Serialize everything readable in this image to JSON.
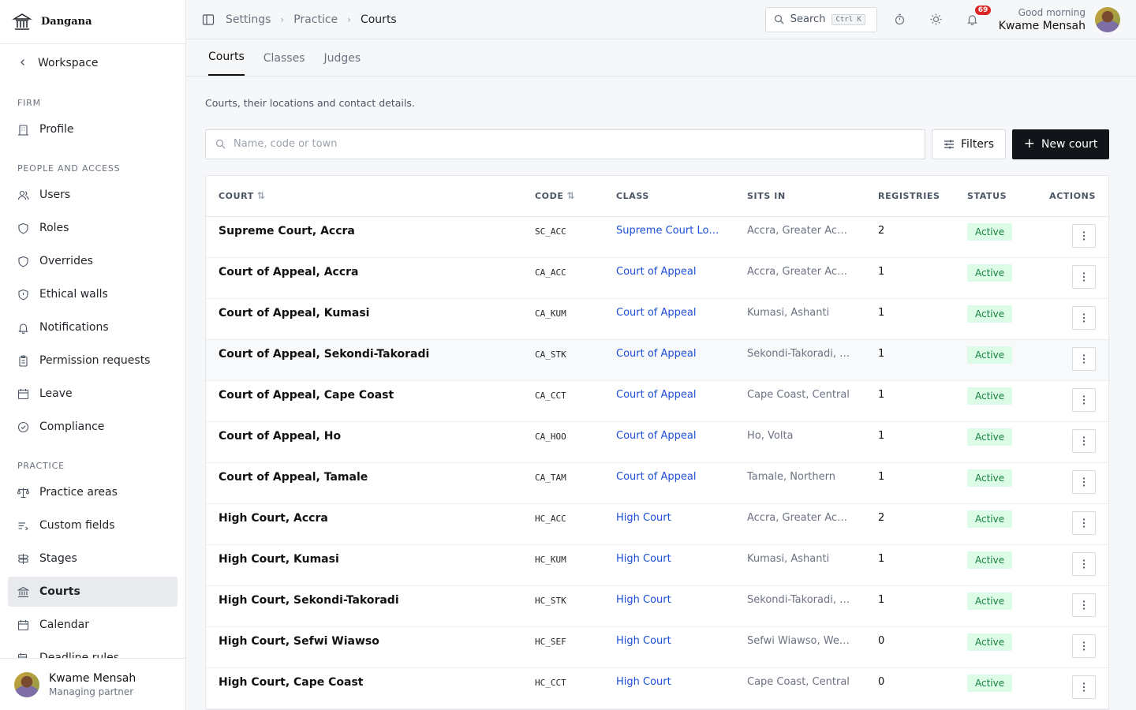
{
  "brand": {
    "name": "Dangana"
  },
  "sidebar": {
    "back_label": "Workspace",
    "sections": [
      {
        "label": "FIRM",
        "items": [
          {
            "label": "Profile",
            "icon": "building-icon"
          }
        ]
      },
      {
        "label": "PEOPLE AND ACCESS",
        "items": [
          {
            "label": "Users",
            "icon": "users-icon"
          },
          {
            "label": "Roles",
            "icon": "shield-icon"
          },
          {
            "label": "Overrides",
            "icon": "shield-icon"
          },
          {
            "label": "Ethical walls",
            "icon": "shield-alert-icon"
          },
          {
            "label": "Notifications",
            "icon": "bell-icon"
          },
          {
            "label": "Permission requests",
            "icon": "clipboard-icon"
          },
          {
            "label": "Leave",
            "icon": "calendar-icon"
          },
          {
            "label": "Compliance",
            "icon": "check-circle-icon"
          }
        ]
      },
      {
        "label": "PRACTICE",
        "items": [
          {
            "label": "Practice areas",
            "icon": "scale-icon"
          },
          {
            "label": "Custom fields",
            "icon": "list-icon"
          },
          {
            "label": "Stages",
            "icon": "signpost-icon"
          },
          {
            "label": "Courts",
            "icon": "landmark-icon",
            "active": true
          },
          {
            "label": "Calendar",
            "icon": "calendar-icon"
          },
          {
            "label": "Deadline rules",
            "icon": "calendar-clock-icon"
          }
        ]
      }
    ],
    "footer": {
      "name": "Kwame Mensah",
      "role": "Managing partner"
    }
  },
  "topbar": {
    "breadcrumb": [
      "Settings",
      "Practice",
      "Courts"
    ],
    "search_label": "Search",
    "search_shortcut": "Ctrl K",
    "notification_count": "69",
    "greeting": "Good morning",
    "user_name": "Kwame Mensah"
  },
  "tabs": [
    "Courts",
    "Classes",
    "Judges"
  ],
  "active_tab": "Courts",
  "page": {
    "description": "Courts, their locations and contact details.",
    "search_placeholder": "Name, code or town",
    "filters_label": "Filters",
    "new_label": "New court"
  },
  "table": {
    "columns": [
      "COURT",
      "CODE",
      "CLASS",
      "SITS IN",
      "REGISTRIES",
      "STATUS",
      "ACTIONS"
    ],
    "rows": [
      {
        "court": "Supreme Court, Accra",
        "code": "SC_ACC",
        "class": "Supreme Court Lore...",
        "sits": "Accra, Greater Accra",
        "registries": "2",
        "status": "Active"
      },
      {
        "court": "Court of Appeal, Accra",
        "code": "CA_ACC",
        "class": "Court of Appeal",
        "sits": "Accra, Greater Accra",
        "registries": "1",
        "status": "Active"
      },
      {
        "court": "Court of Appeal, Kumasi",
        "code": "CA_KUM",
        "class": "Court of Appeal",
        "sits": "Kumasi, Ashanti",
        "registries": "1",
        "status": "Active"
      },
      {
        "court": "Court of Appeal, Sekondi-Takoradi",
        "code": "CA_STK",
        "class": "Court of Appeal",
        "sits": "Sekondi-Takoradi, W...",
        "registries": "1",
        "status": "Active",
        "highlight": true
      },
      {
        "court": "Court of Appeal, Cape Coast",
        "code": "CA_CCT",
        "class": "Court of Appeal",
        "sits": "Cape Coast, Central",
        "registries": "1",
        "status": "Active"
      },
      {
        "court": "Court of Appeal, Ho",
        "code": "CA_HOO",
        "class": "Court of Appeal",
        "sits": "Ho, Volta",
        "registries": "1",
        "status": "Active"
      },
      {
        "court": "Court of Appeal, Tamale",
        "code": "CA_TAM",
        "class": "Court of Appeal",
        "sits": "Tamale, Northern",
        "registries": "1",
        "status": "Active"
      },
      {
        "court": "High Court, Accra",
        "code": "HC_ACC",
        "class": "High Court",
        "sits": "Accra, Greater Accra",
        "registries": "2",
        "status": "Active"
      },
      {
        "court": "High Court, Kumasi",
        "code": "HC_KUM",
        "class": "High Court",
        "sits": "Kumasi, Ashanti",
        "registries": "1",
        "status": "Active"
      },
      {
        "court": "High Court, Sekondi-Takoradi",
        "code": "HC_STK",
        "class": "High Court",
        "sits": "Sekondi-Takoradi, W...",
        "registries": "1",
        "status": "Active"
      },
      {
        "court": "High Court, Sefwi Wiawso",
        "code": "HC_SEF",
        "class": "High Court",
        "sits": "Sefwi Wiawso, West...",
        "registries": "0",
        "status": "Active"
      },
      {
        "court": "High Court, Cape Coast",
        "code": "HC_CCT",
        "class": "High Court",
        "sits": "Cape Coast, Central",
        "registries": "0",
        "status": "Active"
      }
    ]
  },
  "colors": {
    "accent_link": "#1d4ed8",
    "status_bg": "#dcfce7",
    "status_text": "#15803d",
    "primary_button": "#111418",
    "badge": "#dc2626"
  }
}
